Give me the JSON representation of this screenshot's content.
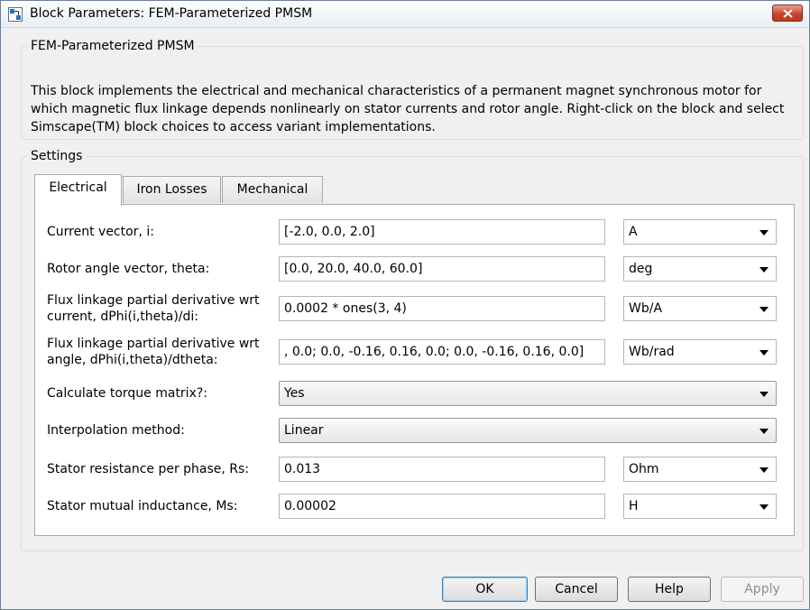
{
  "window": {
    "title": "Block Parameters: FEM-Parameterized PMSM",
    "icons": {
      "app": "simulink-block-icon",
      "close": "close-icon"
    }
  },
  "block": {
    "name": "FEM-Parameterized PMSM",
    "description": "This block implements the electrical and mechanical characteristics of a permanent magnet synchronous motor for which magnetic flux linkage depends nonlinearly on stator currents and rotor angle. Right-click on the block and select Simscape(TM) block choices to access variant implementations."
  },
  "settings": {
    "label": "Settings",
    "tabs": [
      {
        "label": "Electrical",
        "active": true
      },
      {
        "label": "Iron Losses",
        "active": false
      },
      {
        "label": "Mechanical",
        "active": false
      }
    ],
    "params": {
      "current_vector": {
        "label": "Current vector, i:",
        "value": "[-2.0, 0.0, 2.0]",
        "unit": "A"
      },
      "rotor_angle": {
        "label": "Rotor angle vector, theta:",
        "value": "[0.0, 20.0, 40.0, 60.0]",
        "unit": "deg"
      },
      "flux_di": {
        "label_line1": "Flux linkage partial derivative wrt",
        "label_line2": "current, dPhi(i,theta)/di:",
        "value": "0.0002 * ones(3, 4)",
        "unit": "Wb/A"
      },
      "flux_dtheta": {
        "label_line1": "Flux linkage partial derivative wrt",
        "label_line2": "angle, dPhi(i,theta)/dtheta:",
        "value": ", 0.0; 0.0, -0.16, 0.16, 0.0; 0.0, -0.16, 0.16, 0.0]",
        "unit": "Wb/rad"
      },
      "torque_matrix": {
        "label": "Calculate torque matrix?:",
        "value": "Yes"
      },
      "interpolation": {
        "label": "Interpolation method:",
        "value": "Linear"
      },
      "stator_resistance": {
        "label": "Stator resistance per phase, Rs:",
        "value": "0.013",
        "unit": "Ohm"
      },
      "mutual_inductance": {
        "label": "Stator mutual inductance, Ms:",
        "value": "0.00002",
        "unit": "H"
      }
    }
  },
  "buttons": {
    "ok": "OK",
    "cancel": "Cancel",
    "help": "Help",
    "apply": "Apply"
  }
}
